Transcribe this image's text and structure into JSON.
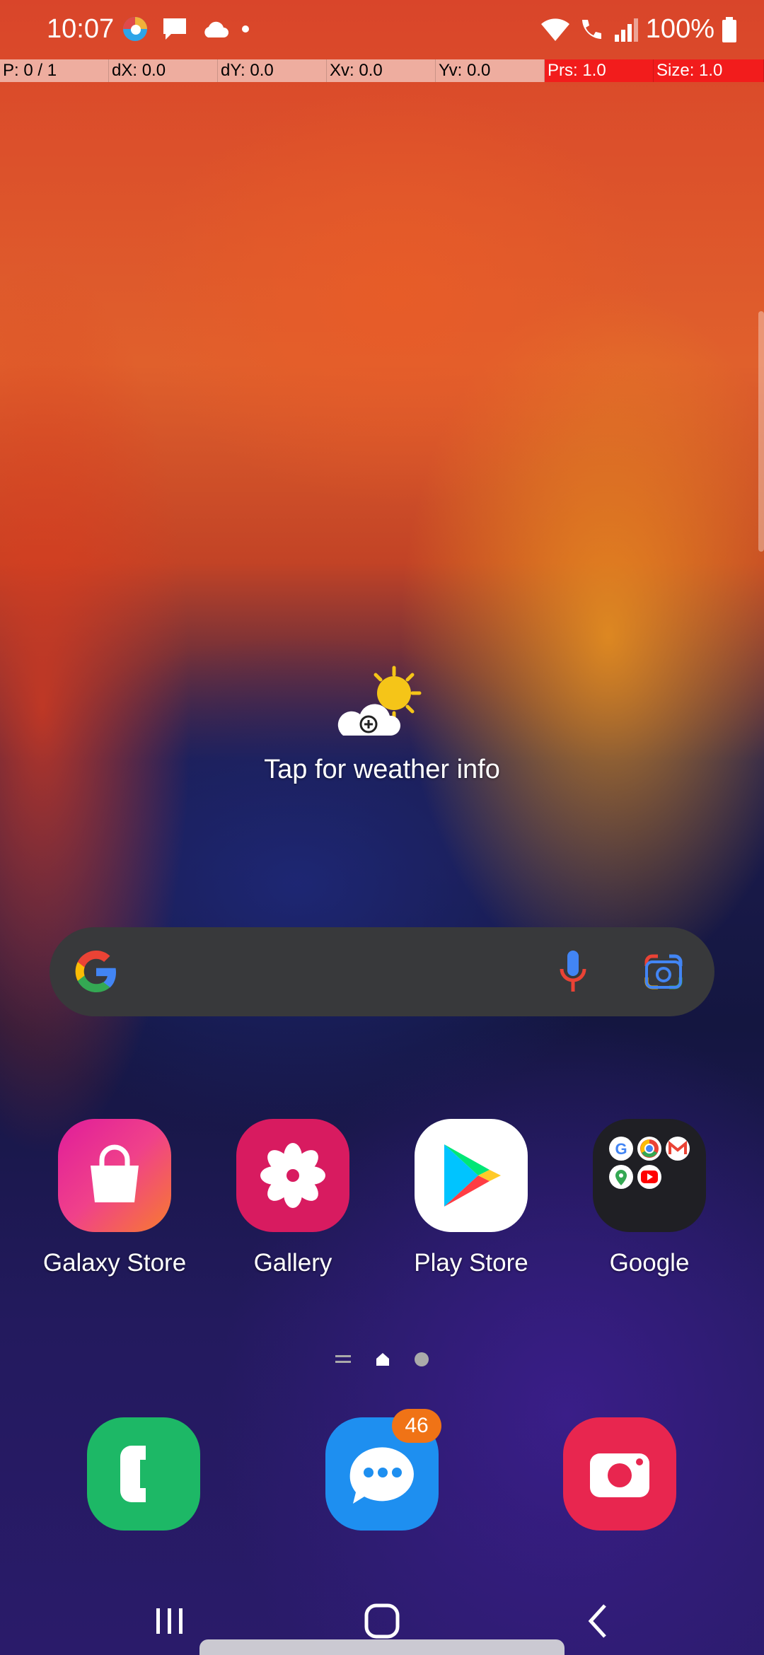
{
  "status_bar": {
    "time": "10:07",
    "battery": "100%"
  },
  "pointer_overlay": {
    "pointers": "P: 0 / 1",
    "dx": "dX: 0.0",
    "dy": "dY: 0.0",
    "xv": "Xv: 0.0",
    "yv": "Yv: 0.0",
    "prs": "Prs: 1.0",
    "size": "Size: 1.0"
  },
  "weather": {
    "text": "Tap for weather info",
    "icon": "sun-cloud-add-icon"
  },
  "search": {
    "logo": "google-g-icon",
    "mic": "mic-icon",
    "lens": "google-lens-icon"
  },
  "apps": [
    {
      "label": "Galaxy Store",
      "icon": "galaxy-store-icon"
    },
    {
      "label": "Gallery",
      "icon": "gallery-flower-icon"
    },
    {
      "label": "Play Store",
      "icon": "play-store-icon"
    },
    {
      "label": "Google",
      "icon": "google-folder-icon"
    }
  ],
  "dock": [
    {
      "name": "Phone",
      "icon": "phone-icon"
    },
    {
      "name": "Messages",
      "icon": "messages-icon",
      "badge": "46"
    },
    {
      "name": "Camera",
      "icon": "camera-icon"
    }
  ],
  "colors": {
    "search_bg": "#38393b",
    "badge": "#f07316",
    "phone": "#1db866",
    "messages": "#1e8ff0",
    "camera": "#e8264f",
    "gallery": "#d81b60"
  }
}
